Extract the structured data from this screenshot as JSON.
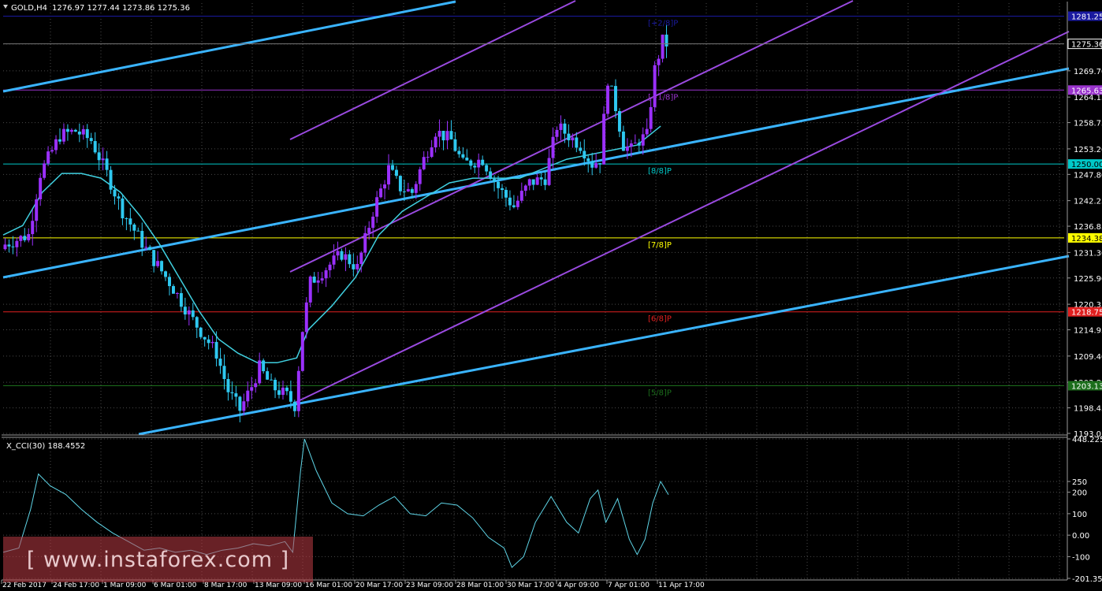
{
  "header": {
    "symbol": "GOLD,H4",
    "ohlc": "1276.97 1277.44 1273.86 1275.36"
  },
  "indicator": {
    "title": "X_CCI(30) 188.4552",
    "axis_labels": [
      "448.2258",
      "250",
      "200",
      "100",
      "0.00",
      "-100",
      "-201.3518"
    ]
  },
  "watermark": "[ www.instaforex.com ]",
  "colors": {
    "background": "#000000",
    "grid": "#4a4a4a",
    "bull_candle": "#9b30ff",
    "bear_candle": "#2ec8f0",
    "channel_blue": "#3ab4ff",
    "channel_purple": "#9a4ae0",
    "moving_average": "#40d0e0",
    "cci_line": "#5fd6e8",
    "level_yellow": "#ffff00",
    "level_red": "#e02020",
    "level_green": "#1c6e1c",
    "level_teal": "#00c8c8",
    "level_purple": "#9933cc",
    "level_navy": "#1a1aa0"
  },
  "chart_data": [
    {
      "type": "candlestick",
      "title": "GOLD,H4",
      "ylim": [
        1193.05,
        1284.0
      ],
      "price_axis_labels": [
        "1275.36",
        "1269.70",
        "1264.15",
        "1258.75",
        "1253.20",
        "1247.80",
        "1242.25",
        "1236.85",
        "1231.30",
        "1225.90",
        "1220.35",
        "1214.95",
        "1209.40",
        "1203.85",
        "1198.45",
        "1193.05"
      ],
      "highlighted_prices": [
        {
          "label": "1250.00",
          "color": "#00c8c8"
        },
        {
          "label": "1234.38",
          "color": "#ffff00"
        },
        {
          "label": "1218.75",
          "color": "#e02020"
        },
        {
          "label": "1203.13",
          "color": "#1c6e1c"
        },
        {
          "label": "1265.63",
          "color": "#9933cc"
        },
        {
          "label": "1281.25",
          "color": "#1a1aa0"
        }
      ],
      "levels": [
        {
          "label": "[8/8]P",
          "price": 1250.0,
          "color": "#00c8c8"
        },
        {
          "label": "[7/8]P",
          "price": 1234.38,
          "color": "#ffff00"
        },
        {
          "label": "[6/8]P",
          "price": 1218.75,
          "color": "#e02020"
        },
        {
          "label": "[5/8]P",
          "price": 1203.13,
          "color": "#1c6e1c"
        },
        {
          "label": "[+1/8]P",
          "price": 1265.63,
          "color": "#9933cc"
        },
        {
          "label": "[+2/8]P",
          "price": 1281.25,
          "color": "#1a1aa0"
        }
      ],
      "x_labels": [
        "22 Feb 2017",
        "24 Feb 17:00",
        "1 Mar 09:00",
        "6 Mar 01:00",
        "8 Mar 17:00",
        "13 Mar 09:00",
        "16 Mar 01:00",
        "20 Mar 17:00",
        "23 Mar 09:00",
        "28 Mar 01:00",
        "30 Mar 17:00",
        "4 Apr 09:00",
        "7 Apr 01:00",
        "11 Apr 17:00"
      ],
      "close_anchors": [
        [
          0,
          1233
        ],
        [
          6,
          1235
        ],
        [
          9,
          1248
        ],
        [
          14,
          1256
        ],
        [
          18,
          1257
        ],
        [
          22,
          1255
        ],
        [
          26,
          1248
        ],
        [
          30,
          1240
        ],
        [
          36,
          1232
        ],
        [
          42,
          1225
        ],
        [
          48,
          1217
        ],
        [
          54,
          1210
        ],
        [
          57,
          1202
        ],
        [
          60,
          1198
        ],
        [
          63,
          1203
        ],
        [
          65,
          1207
        ],
        [
          68,
          1203
        ],
        [
          72,
          1201
        ],
        [
          74,
          1199
        ],
        [
          76,
          1215
        ],
        [
          78,
          1225
        ],
        [
          82,
          1228
        ],
        [
          86,
          1231
        ],
        [
          90,
          1228
        ],
        [
          94,
          1240
        ],
        [
          98,
          1249
        ],
        [
          101,
          1245
        ],
        [
          104,
          1244
        ],
        [
          107,
          1251
        ],
        [
          110,
          1257
        ],
        [
          114,
          1255
        ],
        [
          117,
          1250
        ],
        [
          122,
          1251
        ],
        [
          126,
          1245
        ],
        [
          130,
          1241
        ],
        [
          134,
          1246
        ],
        [
          138,
          1247
        ],
        [
          141,
          1258
        ],
        [
          144,
          1256
        ],
        [
          147,
          1254
        ],
        [
          150,
          1250
        ],
        [
          152,
          1251
        ],
        [
          154,
          1268
        ],
        [
          156,
          1262
        ],
        [
          158,
          1254
        ],
        [
          160,
          1253
        ],
        [
          162,
          1255
        ],
        [
          164,
          1256
        ],
        [
          166,
          1270
        ],
        [
          168,
          1276
        ],
        [
          169,
          1275.4
        ]
      ],
      "moving_average_points": [
        [
          0,
          1235
        ],
        [
          5,
          1237
        ],
        [
          10,
          1244
        ],
        [
          15,
          1248
        ],
        [
          20,
          1248
        ],
        [
          25,
          1247
        ],
        [
          30,
          1244
        ],
        [
          35,
          1239
        ],
        [
          40,
          1233
        ],
        [
          45,
          1226
        ],
        [
          50,
          1219
        ],
        [
          55,
          1213
        ],
        [
          60,
          1210
        ],
        [
          65,
          1208
        ],
        [
          70,
          1208
        ],
        [
          75,
          1209
        ],
        [
          78,
          1215
        ],
        [
          84,
          1220
        ],
        [
          90,
          1226
        ],
        [
          96,
          1235
        ],
        [
          102,
          1240
        ],
        [
          108,
          1243
        ],
        [
          114,
          1246
        ],
        [
          120,
          1247
        ],
        [
          126,
          1247
        ],
        [
          132,
          1247
        ],
        [
          138,
          1249
        ],
        [
          144,
          1251
        ],
        [
          150,
          1252
        ],
        [
          156,
          1253
        ],
        [
          162,
          1254
        ],
        [
          168,
          1258
        ]
      ]
    },
    {
      "type": "line",
      "title": "X_CCI(30) 188.4552",
      "ylim": [
        -201.3518,
        448.2258
      ],
      "series": [
        {
          "points": [
            [
              0,
              -80
            ],
            [
              4,
              -60
            ],
            [
              7,
              120
            ],
            [
              9,
              285
            ],
            [
              12,
              230
            ],
            [
              16,
              190
            ],
            [
              20,
              120
            ],
            [
              24,
              60
            ],
            [
              28,
              10
            ],
            [
              32,
              -30
            ],
            [
              36,
              -70
            ],
            [
              40,
              -60
            ],
            [
              44,
              -80
            ],
            [
              48,
              -70
            ],
            [
              52,
              -90
            ],
            [
              56,
              -70
            ],
            [
              60,
              -60
            ],
            [
              64,
              -40
            ],
            [
              68,
              -50
            ],
            [
              72,
              -30
            ],
            [
              74,
              -80
            ],
            [
              76,
              300
            ],
            [
              77,
              448
            ],
            [
              80,
              300
            ],
            [
              84,
              150
            ],
            [
              88,
              100
            ],
            [
              92,
              90
            ],
            [
              96,
              140
            ],
            [
              100,
              180
            ],
            [
              104,
              100
            ],
            [
              108,
              90
            ],
            [
              112,
              150
            ],
            [
              116,
              140
            ],
            [
              120,
              80
            ],
            [
              124,
              -10
            ],
            [
              128,
              -60
            ],
            [
              130,
              -150
            ],
            [
              133,
              -100
            ],
            [
              136,
              60
            ],
            [
              140,
              180
            ],
            [
              144,
              60
            ],
            [
              147,
              10
            ],
            [
              150,
              170
            ],
            [
              152,
              210
            ],
            [
              154,
              60
            ],
            [
              157,
              170
            ],
            [
              160,
              -20
            ],
            [
              162,
              -90
            ],
            [
              164,
              -20
            ],
            [
              166,
              150
            ],
            [
              168,
              250
            ],
            [
              170,
              188.46
            ]
          ]
        }
      ]
    }
  ]
}
